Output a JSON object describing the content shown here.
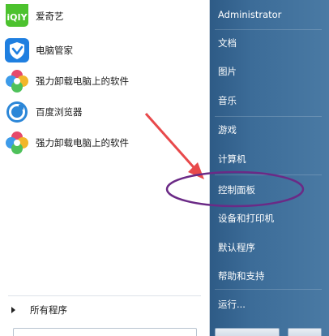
{
  "left_menu": {
    "items": [
      {
        "label": "爱奇艺",
        "icon": "iqiyi-icon"
      },
      {
        "label": "电脑管家",
        "icon": "tencent-pc-manager-icon"
      },
      {
        "label": "强力卸载电脑上的软件",
        "icon": "uninstall-tool-icon"
      },
      {
        "label": "百度浏览器",
        "icon": "baidu-browser-icon"
      },
      {
        "label": "强力卸载电脑上的软件",
        "icon": "uninstall-tool-icon"
      }
    ],
    "all_programs": "所有程序"
  },
  "right_menu": {
    "user": "Administrator",
    "items": [
      "文档",
      "图片",
      "音乐",
      "游戏",
      "计算机",
      "控制面板",
      "设备和打印机",
      "默认程序",
      "帮助和支持",
      "运行..."
    ]
  },
  "annotation": {
    "arrow_color": "#e8494b",
    "ellipse_color": "#6b2a86",
    "highlight_target": "控制面板"
  },
  "colors": {
    "right_pane": "#3c6c98",
    "iqiyi_green": "#4cc22e",
    "pc_manager_blue": "#1f7fe0",
    "baidu_blue": "#2c87d8"
  }
}
